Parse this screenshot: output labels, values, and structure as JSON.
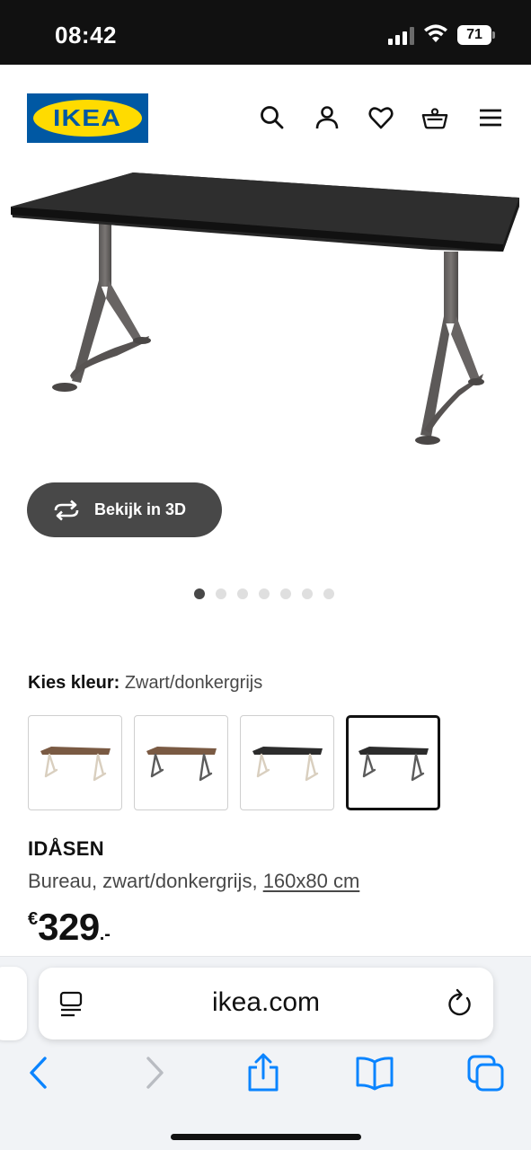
{
  "status_bar": {
    "time": "08:42",
    "battery": "71"
  },
  "header": {
    "logo_text": "IKEA",
    "icons": [
      "search-icon",
      "account-icon",
      "heart-icon",
      "basket-icon",
      "menu-icon"
    ]
  },
  "gallery": {
    "view_3d_label": "Bekijk in 3D",
    "image_count": 7,
    "active_index": 0
  },
  "color_picker": {
    "label": "Kies kleur:",
    "selected_value": "Zwart/donkergrijs",
    "swatches": [
      {
        "top": "#7a5a43",
        "legs": "#d9cfbf"
      },
      {
        "top": "#7a5a43",
        "legs": "#5b5b5b"
      },
      {
        "top": "#2c2c2c",
        "legs": "#d9cfbf"
      },
      {
        "top": "#2c2c2c",
        "legs": "#5b5b5b"
      }
    ],
    "selected_index": 3
  },
  "product": {
    "name": "IDÅSEN",
    "description": "Bureau, zwart/donkergrijs,",
    "size": "160x80 cm",
    "price_currency": "€",
    "price_amount": "329",
    "price_suffix": ".-"
  },
  "browser": {
    "url": "ikea.com",
    "toolbar_icons": [
      "back-icon",
      "forward-icon",
      "share-icon",
      "bookmarks-icon",
      "tabs-icon"
    ]
  },
  "colors": {
    "ikea_blue": "#0058a3",
    "ikea_yellow": "#ffdb00",
    "ios_blue": "#0a84ff",
    "button_dark": "#484848"
  }
}
